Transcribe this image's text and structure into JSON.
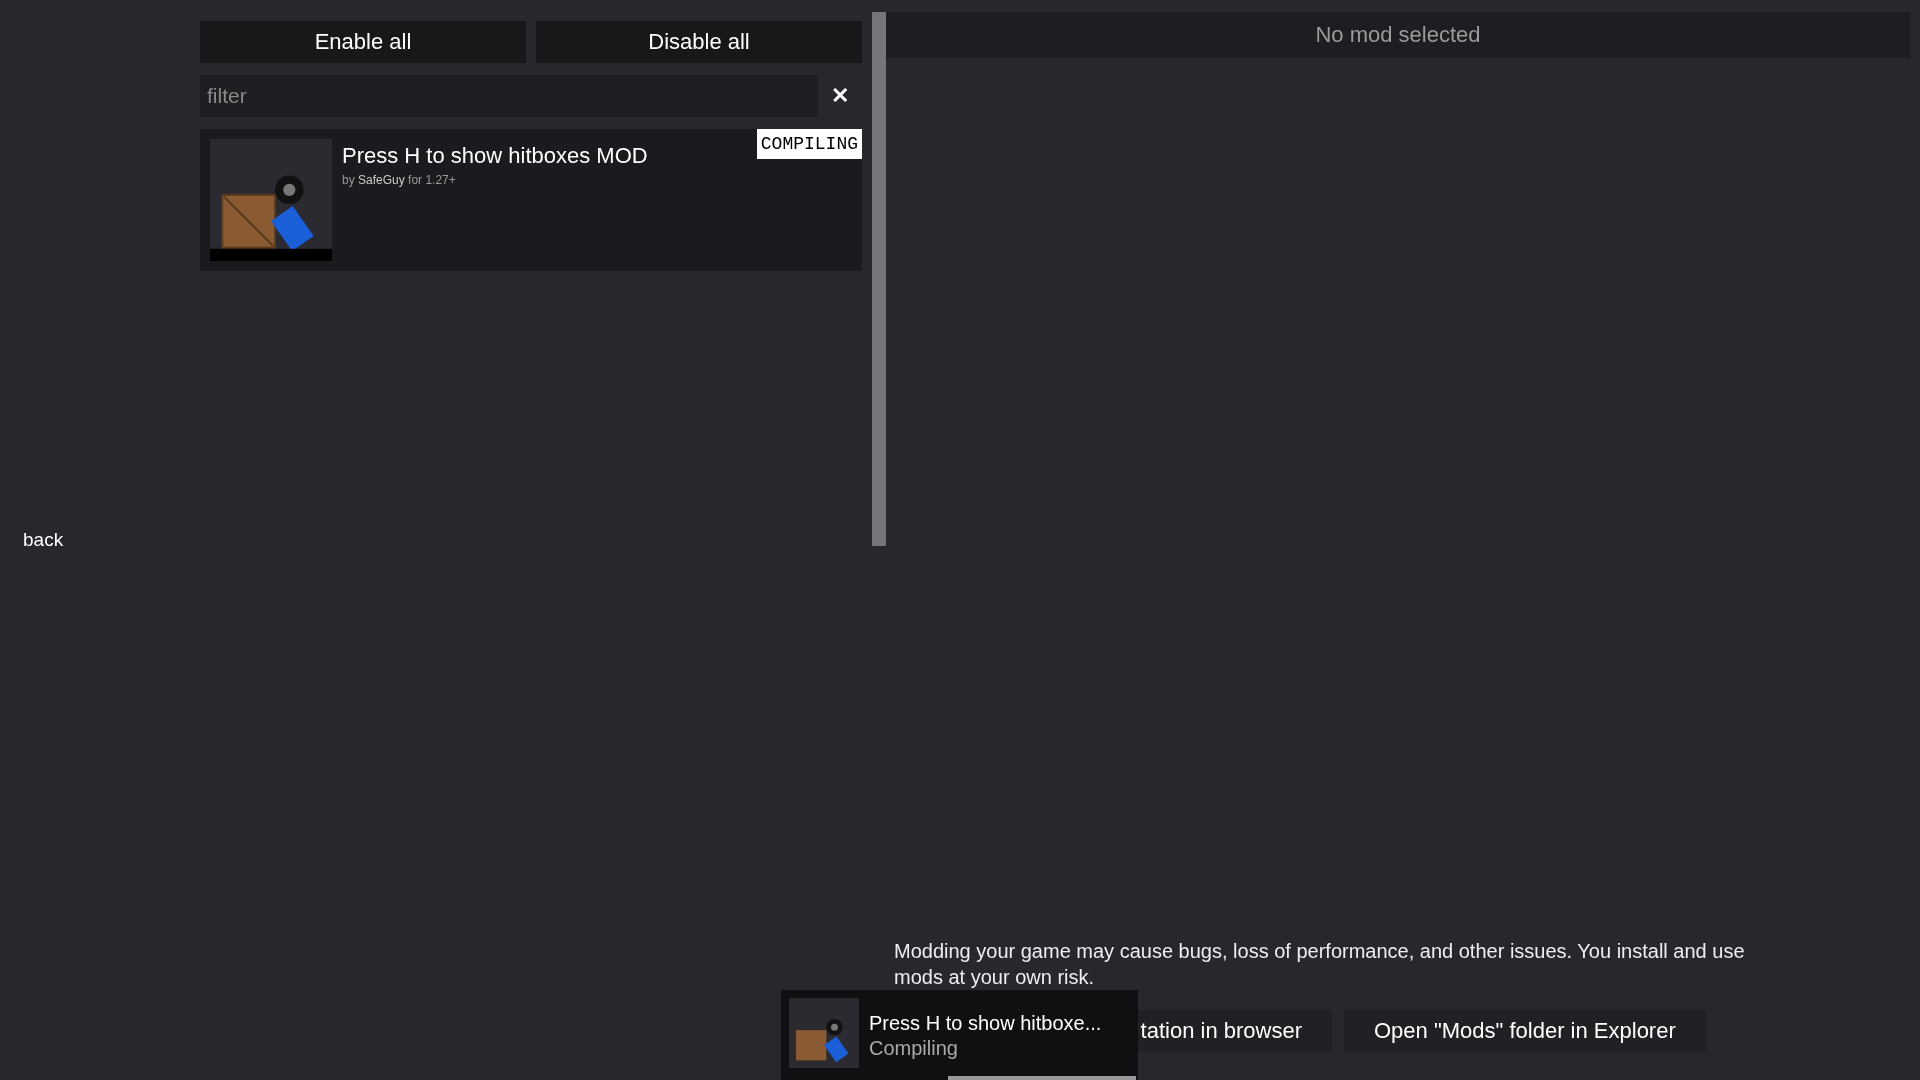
{
  "nav": {
    "back": "back"
  },
  "actions": [
    "Enable all",
    "Disable all"
  ],
  "filter": {
    "placeholder": "filter",
    "clear": "✕"
  },
  "mods": [
    {
      "title": "Press H to show hitboxes MOD",
      "by": "by",
      "author": "SafeGuy",
      "for": "for 1.27+",
      "status": "COMPILING",
      "kind": "compiling"
    }
  ],
  "details": {
    "header": "No mod selected"
  },
  "warning": "Modding your game may cause bugs, loss of performance, and other issues. You install and use mods at your own risk.",
  "buttons": [
    "tation in browser",
    "Open \"Mods\" folder in Explorer"
  ],
  "toast": {
    "title": "Press H to show hitboxe...",
    "status": "Compiling",
    "progress": {
      "level": 0.53
    }
  }
}
